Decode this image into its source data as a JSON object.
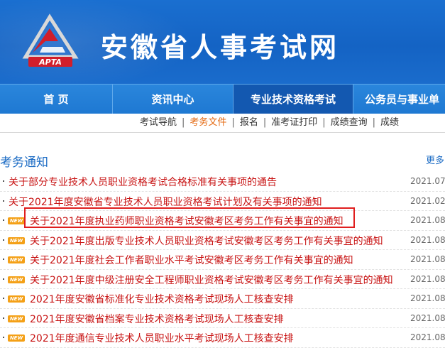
{
  "header": {
    "site_title": "安徽省人事考试网",
    "logo_text": "APTA"
  },
  "nav": {
    "items": [
      {
        "label": "首  页"
      },
      {
        "label": "资讯中心"
      },
      {
        "label": "专业技术资格考试",
        "active": true
      },
      {
        "label": "公务员与事业单"
      }
    ]
  },
  "subnav": {
    "items": [
      {
        "label": "考试导航"
      },
      {
        "label": "考务文件",
        "active": true
      },
      {
        "label": "报名"
      },
      {
        "label": "准考证打印"
      },
      {
        "label": "成绩查询"
      },
      {
        "label": "成绩"
      }
    ],
    "divider": "|"
  },
  "section": {
    "title": "考务通知",
    "more": "更多"
  },
  "notices": [
    {
      "title": "关于部分专业技术人员职业资格考试合格标准有关事项的通告",
      "date": "2021.07.",
      "new": false
    },
    {
      "title": "关于2021年度安徽省专业技术人员职业资格考试计划及有关事项的通知",
      "date": "2021.02.",
      "new": false
    },
    {
      "title": "关于2021年度执业药师职业资格考试安徽考区考务工作有关事宜的通知",
      "date": "2021.08.",
      "new": true,
      "highlighted": true
    },
    {
      "title": "关于2021年度出版专业技术人员职业资格考试安徽考区考务工作有关事宜的通知",
      "date": "2021.08.",
      "new": true
    },
    {
      "title": "关于2021年度社会工作者职业水平考试安徽考区考务工作有关事宜的通知",
      "date": "2021.08.",
      "new": true
    },
    {
      "title": "关于2021年度中级注册安全工程师职业资格考试安徽考区考务工作有关事宜的通知",
      "date": "2021.08.",
      "new": true
    },
    {
      "title": "2021年度安徽省标准化专业技术资格考试现场人工核查安排",
      "date": "2021.08.",
      "new": true
    },
    {
      "title": "2021年度安徽省档案专业技术资格考试现场人工核查安排",
      "date": "2021.08.",
      "new": true
    },
    {
      "title": "2021年度通信专业技术人员职业水平考试现场人工核查安排",
      "date": "2021.08.",
      "new": true
    }
  ],
  "new_badge": "NEW",
  "colors": {
    "header_blue": "#1463c4",
    "nav_blue": "#1e78d2",
    "nav_active": "#1358b0",
    "notice_red": "#c81414",
    "subnav_active": "#e56a12",
    "highlight": "#e01e1e"
  }
}
